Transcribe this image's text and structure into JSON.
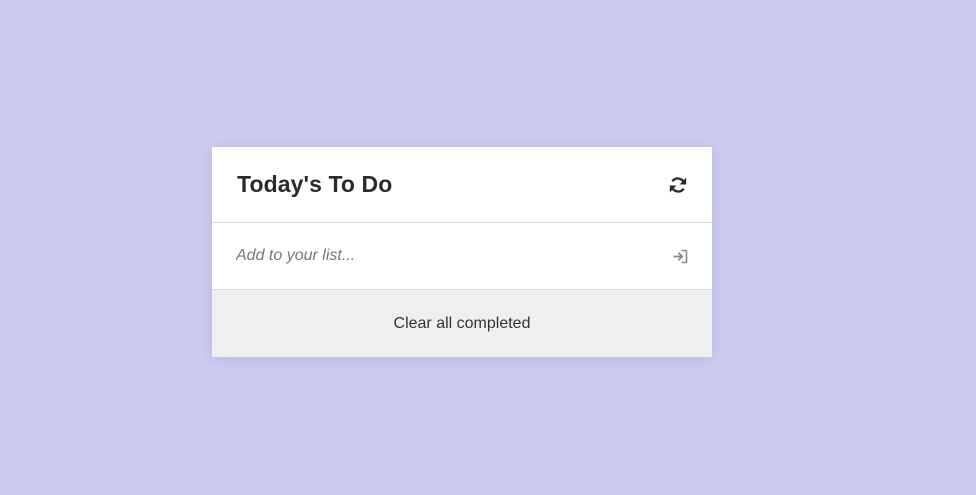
{
  "todo": {
    "title": "Today's To Do",
    "refresh_icon": "refresh-icon",
    "input": {
      "placeholder": "Add to your list...",
      "value": "",
      "submit_icon": "sign-in-arrow-icon"
    },
    "clear_label": "Clear all completed"
  },
  "colors": {
    "background": "#cccbef",
    "card": "#ffffff",
    "footer": "#efefef",
    "title_text": "#2b2b2b",
    "icon": "#2b2b2b",
    "placeholder": "#777777"
  }
}
